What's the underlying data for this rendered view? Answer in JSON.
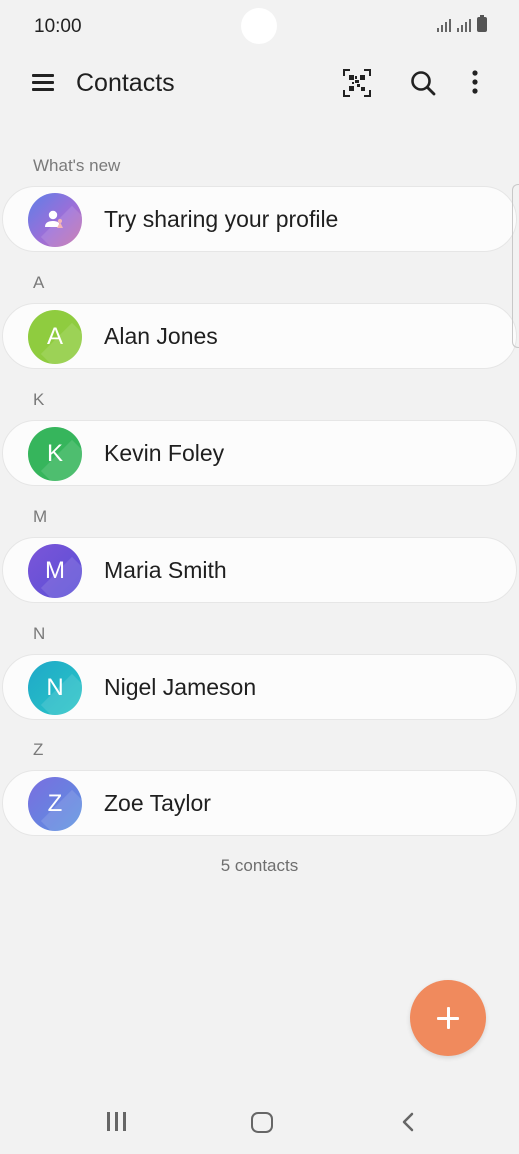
{
  "status_bar": {
    "time": "10:00"
  },
  "app_bar": {
    "title": "Contacts",
    "icons": [
      "menu-icon",
      "qr-code-icon",
      "search-icon",
      "more-options-icon"
    ]
  },
  "profile_section": {
    "header": "What's new",
    "card_label": "Try sharing your profile",
    "icon": "profile-share-icon"
  },
  "contacts": [
    {
      "section": "A",
      "initial": "A",
      "name": "Alan Jones",
      "color": "#8fcc3f"
    },
    {
      "section": "K",
      "initial": "K",
      "name": "Kevin Foley",
      "color": "#36b55c"
    },
    {
      "section": "M",
      "initial": "M",
      "name": "Maria Smith",
      "color": "#6a4fd6"
    },
    {
      "section": "N",
      "initial": "N",
      "name": "Nigel Jameson",
      "color": "#22b8c8"
    },
    {
      "section": "Z",
      "initial": "Z",
      "name": "Zoe Taylor",
      "color": "#6a7fe0"
    }
  ],
  "footer": {
    "count_label": "5 contacts"
  },
  "fab": {
    "icon": "plus-icon",
    "color": "#f08a5d"
  },
  "nav_bar": {
    "icons": [
      "recents-icon",
      "home-icon",
      "back-icon"
    ]
  }
}
